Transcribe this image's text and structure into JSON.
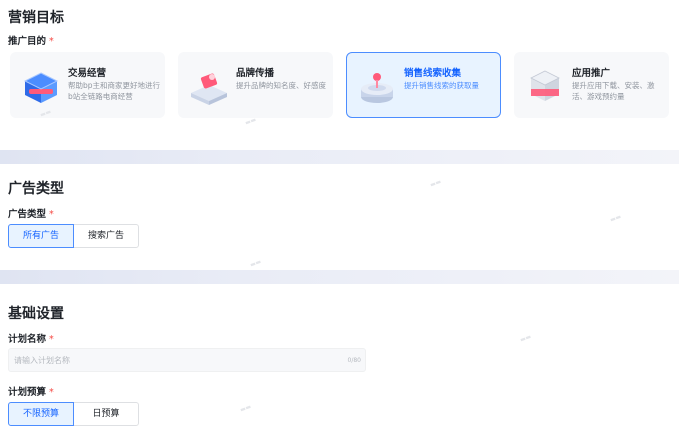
{
  "marketing": {
    "title": "营销目标",
    "purpose_label": "推广目的",
    "required_mark": "*",
    "cards": [
      {
        "title": "交易经营",
        "desc": "帮助bp主和商家更好地进行b站全链路电商经营",
        "icon": "trade-icon",
        "selected": false
      },
      {
        "title": "品牌传播",
        "desc": "提升品牌的知名度、好感度",
        "icon": "brand-icon",
        "selected": false
      },
      {
        "title": "销售线索收集",
        "desc": "提升销售线索的获取量",
        "icon": "lead-icon",
        "selected": true
      },
      {
        "title": "应用推广",
        "desc": "提升应用下载、安装、激活、游戏预约量",
        "icon": "app-icon",
        "selected": false
      }
    ]
  },
  "ad_type": {
    "title": "广告类型",
    "label": "广告类型",
    "required_mark": "*",
    "options": [
      "所有广告",
      "搜索广告"
    ],
    "selected": "所有广告"
  },
  "basic": {
    "title": "基础设置",
    "plan_name_label": "计划名称",
    "plan_name_placeholder": "请输入计划名称",
    "plan_name_counter": "0/80",
    "budget_label": "计划预算",
    "required_mark": "*",
    "budget_options": [
      "不限预算",
      "日预算"
    ],
    "budget_selected": "不限预算"
  },
  "colors": {
    "accent": "#1664ff",
    "accent_bg": "#e8f3ff",
    "required": "#f54a45"
  }
}
